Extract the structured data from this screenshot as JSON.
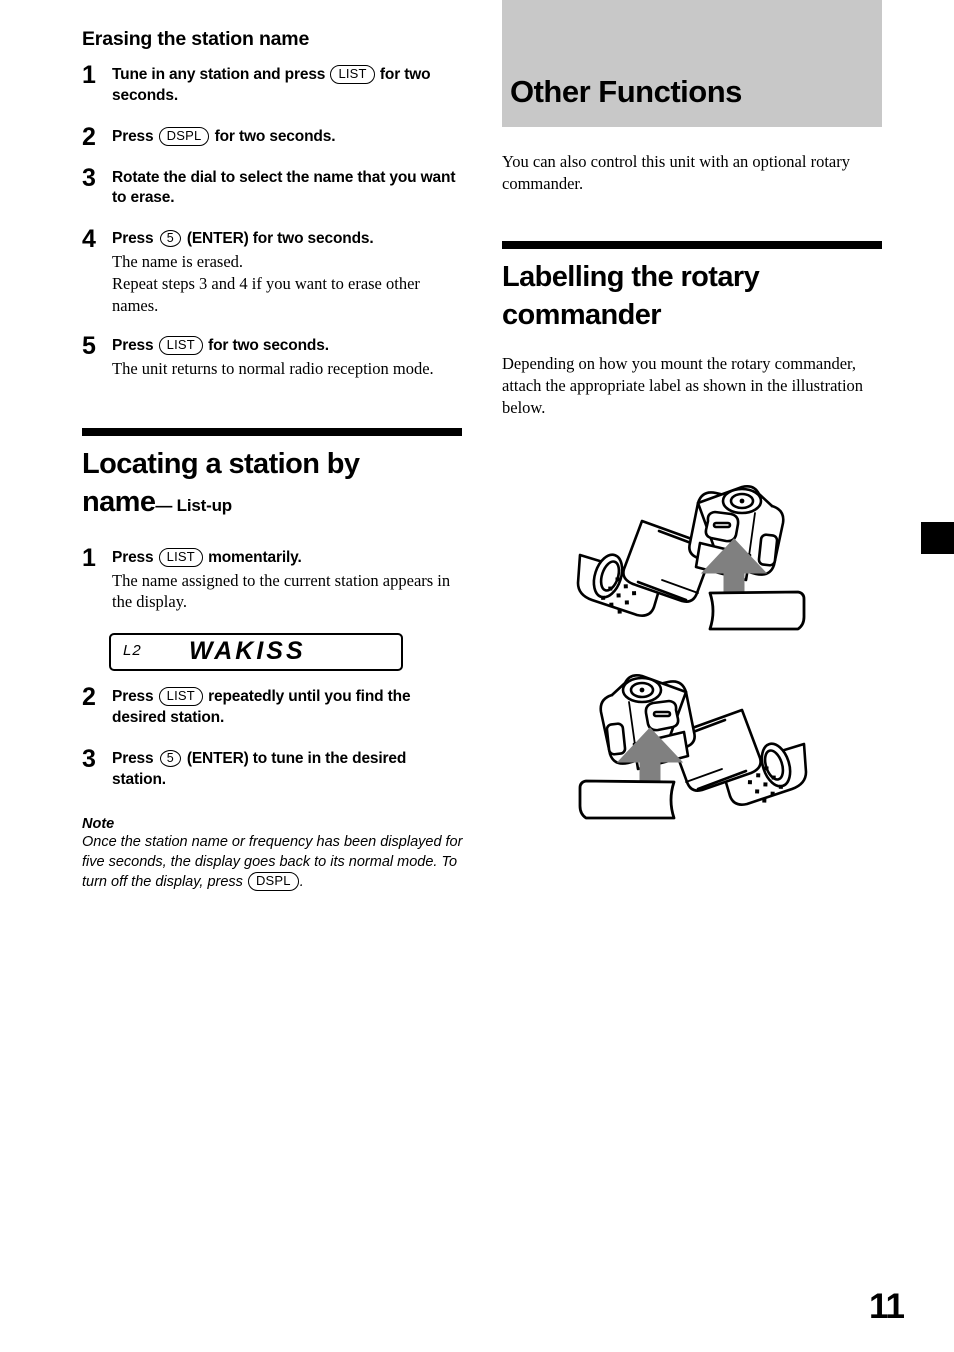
{
  "page": {
    "number": "11",
    "side_tab_color": "#000000",
    "banner_color": "#c8c8c8"
  },
  "left_column": {
    "subsection_title": "Erasing the station name",
    "erasing_steps": [
      {
        "num": "1",
        "title_before": "Tune in any station and press",
        "button": "LIST",
        "title_after": "for two seconds.",
        "body": ""
      },
      {
        "num": "2",
        "title_before": "Press",
        "button": "DSPL",
        "title_after": "for two seconds.",
        "body": ""
      },
      {
        "num": "3",
        "title_before": "Rotate the dial to select the name that you want to erase.",
        "button": "",
        "title_after": "",
        "body": ""
      },
      {
        "num": "4",
        "title_before": "Press",
        "button": "5",
        "title_after": "(ENTER) for two seconds.",
        "body": "The name is erased.\nRepeat steps 3 and 4 if you want to erase other names."
      },
      {
        "num": "5",
        "title_before": "Press",
        "button": "LIST",
        "title_after": "for two seconds.",
        "body": "The unit returns to normal radio reception mode."
      }
    ],
    "section": {
      "title_line1": "Locating a station by",
      "title_line2": "name",
      "title_suffix": "— List-up"
    },
    "locating_steps_a": [
      {
        "num": "1",
        "title_before": "Press",
        "button": "LIST",
        "title_after": "momentarily.",
        "body": "The name assigned to the current station appears in the display."
      }
    ],
    "lcd": {
      "left_text": "L2",
      "main_text": "WAKISS"
    },
    "locating_steps_b": [
      {
        "num": "2",
        "title_before": "Press",
        "button": "LIST",
        "title_after": "repeatedly until you find the desired station.",
        "body": ""
      },
      {
        "num": "3",
        "title_before": "Press",
        "button": "5",
        "title_after": "(ENTER) to tune in the desired station.",
        "body": ""
      }
    ],
    "note": {
      "heading": "Note",
      "text_before": "Once the station name or frequency has been displayed for five seconds, the display goes back to its normal mode. To turn off the display, press",
      "button": "DSPL",
      "text_after": "."
    }
  },
  "right_column": {
    "banner_title": "Other Functions",
    "intro": "You can also control this unit with an optional rotary commander.",
    "section": {
      "title_line1": "Labelling the rotary",
      "title_line2": "commander"
    },
    "description": "Depending on how you mount the rotary commander, attach the appropriate label as shown in the illustration below.",
    "figures": [
      {
        "name": "rotary-commander-label-mount-right"
      },
      {
        "name": "rotary-commander-label-mount-left"
      }
    ]
  }
}
